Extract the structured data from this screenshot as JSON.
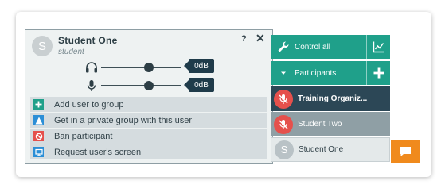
{
  "popup": {
    "avatar_letter": "S",
    "name": "Student One",
    "role": "student",
    "help_label": "?",
    "close_label": "✕",
    "speaker": {
      "icon": "headphones-icon",
      "level": 0.6,
      "db_label": "0dB"
    },
    "microphone": {
      "icon": "microphone-icon",
      "level": 0.6,
      "db_label": "0dB"
    },
    "actions": [
      {
        "label": "Add user to group",
        "icon": "add-group-icon",
        "color": "#1fa08a"
      },
      {
        "label": "Get in a private group with this user",
        "icon": "private-group-icon",
        "color": "#2b8ed6"
      },
      {
        "label": "Ban participant",
        "icon": "ban-icon",
        "color": "#e5504c"
      },
      {
        "label": "Request user's screen",
        "icon": "screen-icon",
        "color": "#2b8ed6"
      }
    ]
  },
  "sidebar": {
    "control_label": "Control all",
    "participants_label": "Participants",
    "participants": [
      {
        "name": "Training Organiz...",
        "avatar": "mic-muted-icon"
      },
      {
        "name": "Student Two",
        "avatar": "mic-muted-icon"
      },
      {
        "name": "Student One",
        "avatar_letter": "S"
      }
    ]
  },
  "colors": {
    "accent": "#1fa08a",
    "dark": "#2c4756",
    "chat": "#f08a1d",
    "danger": "#e5504c"
  }
}
